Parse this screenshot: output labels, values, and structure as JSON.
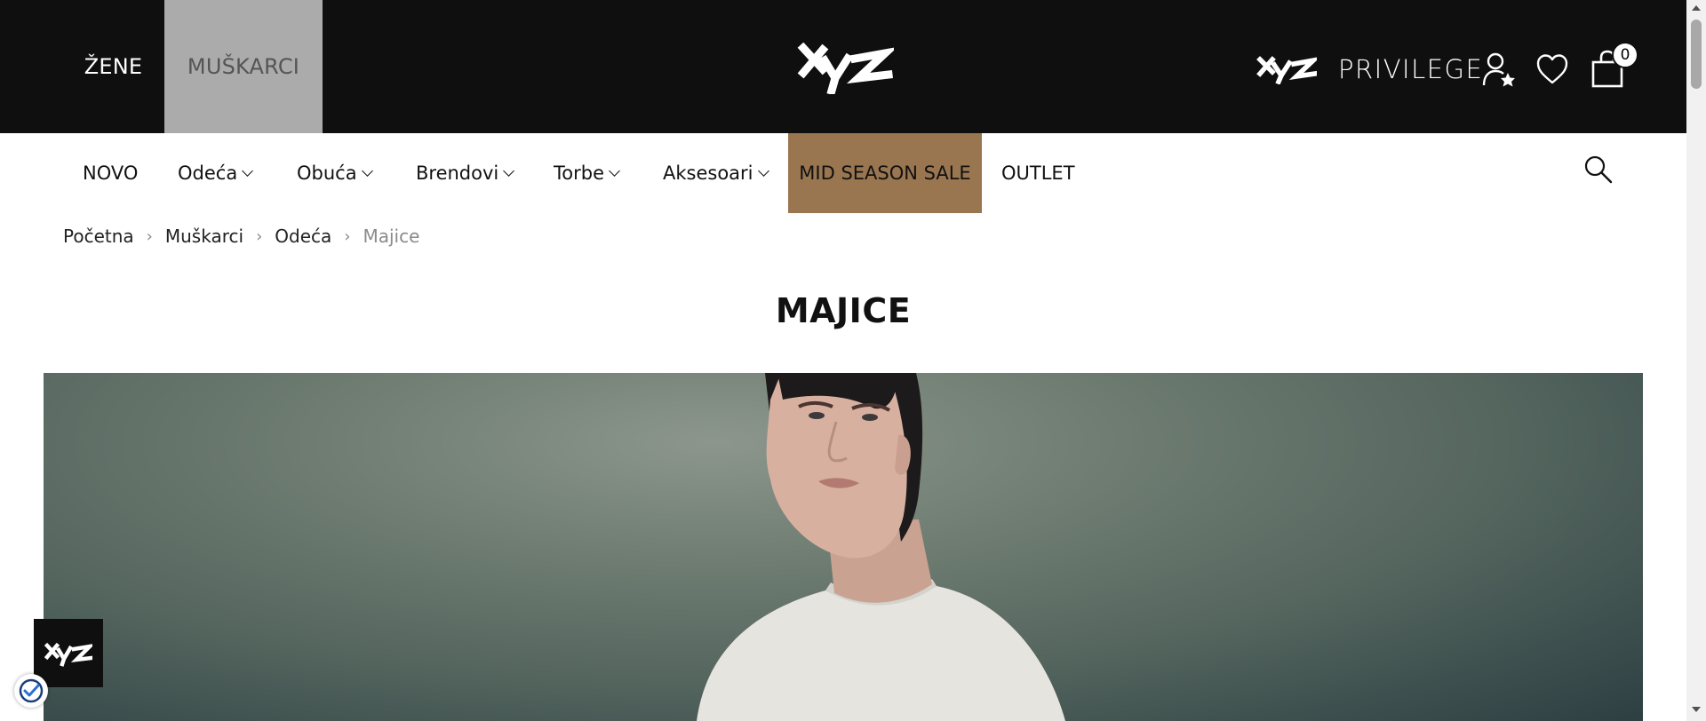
{
  "header": {
    "gender_tabs": [
      {
        "label": "ŽENE",
        "active": false
      },
      {
        "label": "MUŠKARCI",
        "active": true
      }
    ],
    "logo_icon": "xyz-logo",
    "privilege_label": "PRIVILEGE",
    "cart_count": "0"
  },
  "nav": {
    "items": [
      {
        "label": "NOVO"
      },
      {
        "label": "Odeća"
      },
      {
        "label": "Obuća"
      },
      {
        "label": "Brendovi"
      },
      {
        "label": "Torbe"
      },
      {
        "label": "Aksesoari"
      },
      {
        "label": "MID SEASON SALE"
      },
      {
        "label": "OUTLET"
      }
    ],
    "sale_color": "#9a7650"
  },
  "breadcrumb": {
    "items": [
      "Početna",
      "Muškarci",
      "Odeća"
    ],
    "current": "Majice"
  },
  "page": {
    "title": "MAJICE"
  },
  "colors": {
    "topbar": "#0f0f0f",
    "active_gender_bg": "#ababab",
    "sale_bg": "#9a7650"
  }
}
